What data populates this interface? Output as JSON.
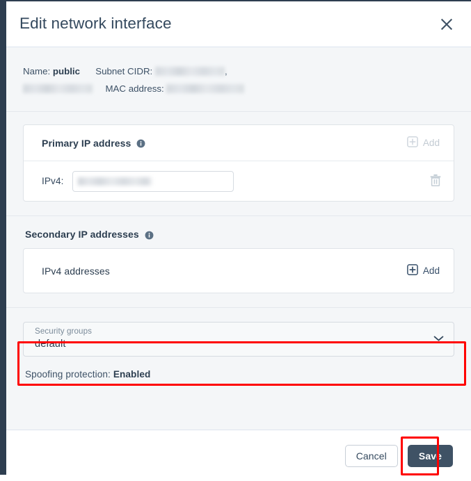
{
  "dialog": {
    "title": "Edit network interface",
    "close_icon": "close-icon"
  },
  "meta": {
    "name_label": "Name:",
    "name_value": "public",
    "subnet_label": "Subnet CIDR:",
    "subnet_value_1": "",
    "subnet_value_2": "",
    "subnet_separator": ",",
    "mac_label": "MAC address:",
    "mac_value": ""
  },
  "primary": {
    "title": "Primary IP address",
    "info_icon": "info-icon",
    "add_label": "Add",
    "add_icon": "plus-square-icon",
    "add_disabled": true,
    "row": {
      "label": "IPv4:",
      "value": "",
      "delete_icon": "trash-icon"
    }
  },
  "secondary": {
    "title": "Secondary IP addresses",
    "info_icon": "info-icon",
    "card_title": "IPv4 addresses",
    "add_label": "Add",
    "add_icon": "plus-square-icon"
  },
  "security_groups": {
    "label": "Security groups",
    "value": "default",
    "chevron_icon": "chevron-down-icon",
    "highlight_color": "#ff0000"
  },
  "spoofing": {
    "label": "Spoofing protection:",
    "value": "Enabled"
  },
  "footer": {
    "cancel_label": "Cancel",
    "save_label": "Save",
    "save_highlight_color": "#ff0000"
  }
}
